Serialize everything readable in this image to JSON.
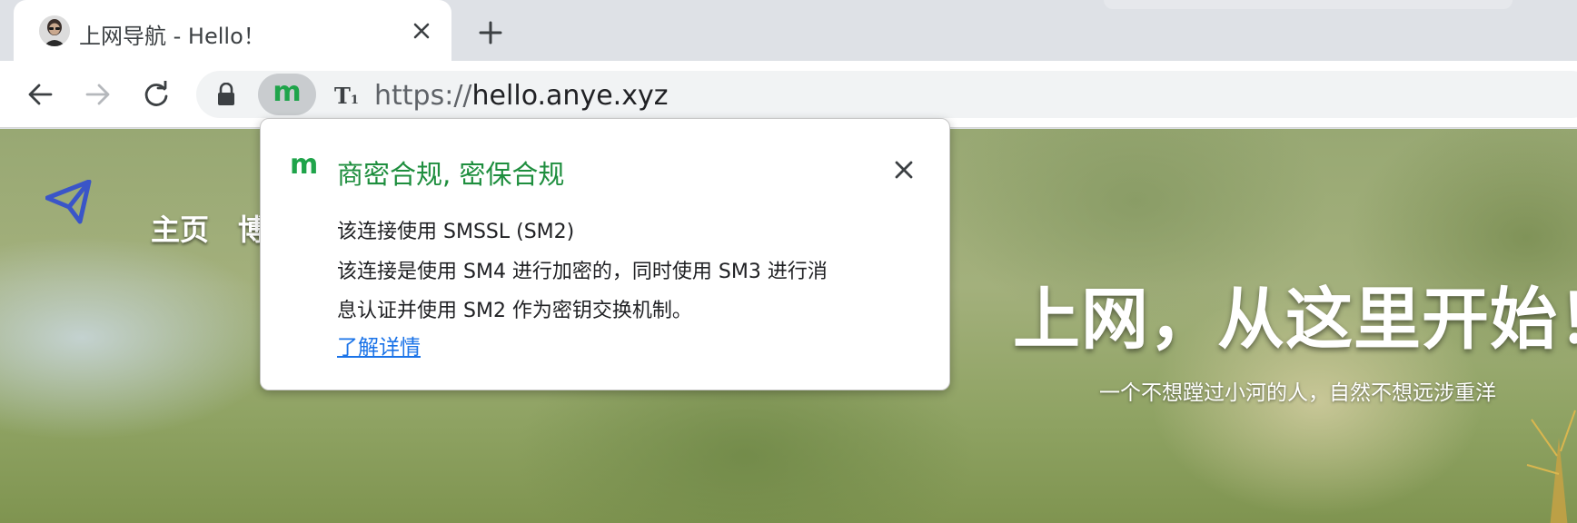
{
  "tab": {
    "title": "上网导航 - Hello！",
    "favicon": "avatar-icon",
    "close_icon": "close-icon"
  },
  "tabstrip": {
    "new_tab_icon": "plus-icon"
  },
  "toolbar": {
    "back_icon": "arrow-left-icon",
    "forward_icon": "arrow-right-icon",
    "reload_icon": "reload-icon"
  },
  "omnibox": {
    "lock_icon": "lock-icon",
    "security_chip_label": "m",
    "translate_icon_label": "T",
    "translate_icon_sub": "1",
    "url_scheme": "https://",
    "url_host": "hello.anye.xyz"
  },
  "page": {
    "logo_icon": "paper-plane-icon",
    "nav": [
      "主页",
      "博"
    ],
    "hero_title": "上网，从这里开始！",
    "hero_subtitle": "一个不想蹚过小河的人，自然不想远涉重洋"
  },
  "security_popup": {
    "badge": "m",
    "title": "商密合规, 密保合规",
    "line1": "该连接使用 SMSSL (SM2)",
    "line2": "该连接是使用 SM4 进行加密的，同时使用 SM3 进行消",
    "line3": "息认证并使用 SM2 作为密钥交换机制。",
    "learn_more": "了解详情",
    "close_icon": "close-icon"
  },
  "colors": {
    "accent_green": "#1e8e3e",
    "badge_green": "#1fa44a",
    "link_blue": "#1a73e8",
    "tabstrip_bg": "#dee1e6",
    "plane_blue": "#3a55c8"
  }
}
